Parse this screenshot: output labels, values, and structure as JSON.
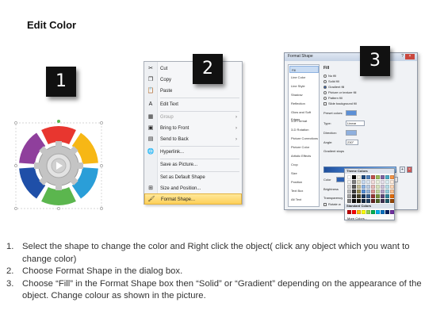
{
  "title": "Edit Color",
  "badges": [
    "1",
    "2",
    "3"
  ],
  "context_menu": {
    "items": [
      {
        "label": "Cut",
        "icon": "scissors-icon"
      },
      {
        "label": "Copy",
        "icon": "copy-icon"
      },
      {
        "label": "Paste",
        "icon": "paste-icon"
      },
      {
        "label": "Edit Text",
        "icon": "edit-text-icon"
      },
      {
        "label": "Group",
        "icon": "group-icon"
      },
      {
        "label": "Bring to Front",
        "icon": "bring-front-icon"
      },
      {
        "label": "Send to Back",
        "icon": "send-back-icon"
      },
      {
        "label": "Hyperlink...",
        "icon": "hyperlink-icon"
      },
      {
        "label": "Save as Picture...",
        "icon": "save-picture-icon"
      },
      {
        "label": "Set as Default Shape",
        "icon": "default-shape-icon"
      },
      {
        "label": "Size and Position...",
        "icon": "size-position-icon"
      },
      {
        "label": "Format Shape...",
        "icon": "format-shape-icon"
      }
    ]
  },
  "dialog": {
    "title": "Format Shape",
    "categories": [
      "Fill",
      "Line Color",
      "Line Style",
      "Shadow",
      "Reflection",
      "Glow and Soft Edges",
      "3-D Format",
      "3-D Rotation",
      "Picture Corrections",
      "Picture Color",
      "Artistic Effects",
      "Crop",
      "Size",
      "Position",
      "Text Box",
      "Alt Text"
    ],
    "fill_heading": "Fill",
    "fill_options": [
      "No fill",
      "Solid fill",
      "Gradient fill",
      "Picture or texture fill",
      "Pattern fill",
      "Slide background fill"
    ],
    "preset_colors_label": "Preset colors:",
    "type_label": "Type:",
    "type_value": "Linear",
    "direction_label": "Direction:",
    "angle_label": "Angle:",
    "angle_value": "230°",
    "gradient_stops_label": "Gradient stops",
    "color_label": "Color",
    "position_label": "Position:",
    "position_value": "0%",
    "brightness_label": "Brightness",
    "transparency_label": "Transparency",
    "rotate_label": "Rotate w",
    "theme_colors_label": "Theme Colors",
    "standard_colors_label": "Standard Colors",
    "more_colors_label": "More Colors..."
  },
  "steps": [
    {
      "num": "1.",
      "text": "Select the shape to change the color and Right click the object( click any object which you want to change color)"
    },
    {
      "num": "2.",
      "text": "Choose Format Shape in the dialog box."
    },
    {
      "num": "3.",
      "text": "Choose “Fill” in the Format Shape box then “Solid” or “Gradient” depending on the appearance of the object. Change colour as shown in the picture."
    }
  ],
  "colors": {
    "segments": [
      "#e8362f",
      "#f7b715",
      "#2a9ed8",
      "#5bb64e",
      "#1f4fa8",
      "#8f3f9c"
    ],
    "gear": "#b5b5b5",
    "highlight": "#fdd05a"
  }
}
